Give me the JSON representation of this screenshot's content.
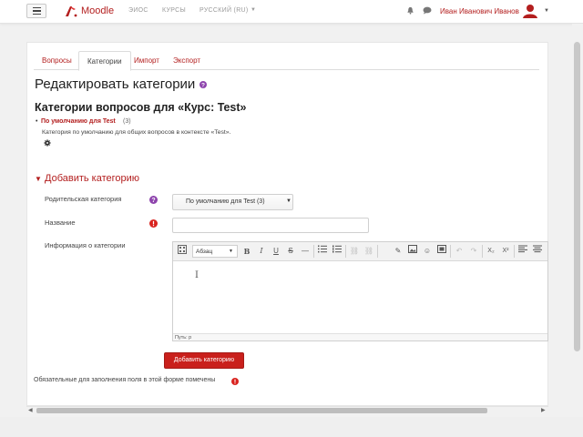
{
  "topnav": {
    "brand": "Moodle",
    "links": [
      "ЭИОС",
      "КУРСЫ",
      "РУССКИЙ (RU)"
    ],
    "user_name": "Иван Иванович Иванов",
    "accent": "#b31e1e",
    "icons": [
      "menu-icon",
      "moodle-logo-icon",
      "bell-icon",
      "chat-icon",
      "user-avatar-icon"
    ]
  },
  "tabs": [
    "Вопросы",
    "Категории",
    "Импорт",
    "Экспорт"
  ],
  "active_tab": "Категории",
  "page_title": "Редактировать категории",
  "section_title": "Категории вопросов для «Курс: Test»",
  "category": {
    "name": "По умолчанию для Test",
    "count": "(3)",
    "description": "Категория по умолчанию для общих вопросов в контексте «Test»."
  },
  "add_section": {
    "heading": "Добавить категорию",
    "parent_label": "Родительская категория",
    "parent_value": "По умолчанию для Test (3)",
    "name_label": "Название",
    "name_value": "",
    "info_label": "Информация о категории",
    "editor_paragraph": "Абзац",
    "editor_path": "Путь: p",
    "submit_label": "Добавить категорию"
  },
  "required_note": "Обязательные для заполнения поля в этой форме помечены",
  "colors": {
    "link": "#b31e1e",
    "button": "#c9201c",
    "help": "#8e44ad",
    "required": "#d9231f"
  }
}
